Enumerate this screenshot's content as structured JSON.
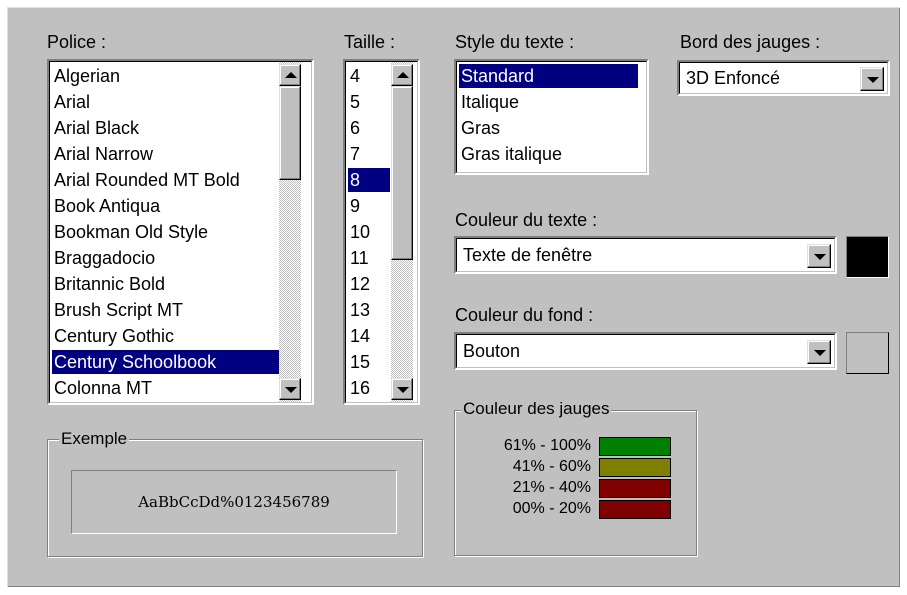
{
  "font": {
    "label": "Police :",
    "items": [
      "Algerian",
      "Arial",
      "Arial Black",
      "Arial Narrow",
      "Arial Rounded MT Bold",
      "Book Antiqua",
      "Bookman Old Style",
      "Braggadocio",
      "Britannic Bold",
      "Brush Script MT",
      "Century Gothic",
      "Century Schoolbook",
      "Colonna MT"
    ],
    "selected": "Century Schoolbook"
  },
  "size": {
    "label": "Taille :",
    "items": [
      "4",
      "5",
      "6",
      "7",
      "8",
      "9",
      "10",
      "11",
      "12",
      "13",
      "14",
      "15",
      "16"
    ],
    "selected": "8"
  },
  "text_style": {
    "label": "Style du texte :",
    "items": [
      "Standard",
      "Italique",
      "Gras",
      "Gras italique"
    ],
    "selected": "Standard"
  },
  "gauge_border": {
    "label": "Bord des jauges :",
    "value": "3D Enfoncé"
  },
  "text_color": {
    "label": "Couleur du texte :",
    "value": "Texte de fenêtre",
    "swatch": "#000000"
  },
  "bg_color": {
    "label": "Couleur du fond :",
    "value": "Bouton",
    "swatch": "#c0c0c0"
  },
  "gauge_colors": {
    "title": "Couleur des jauges",
    "ranges": [
      {
        "label": "61% - 100%",
        "color": "#008000"
      },
      {
        "label": "41% - 60%",
        "color": "#808000"
      },
      {
        "label": "21% - 40%",
        "color": "#800000"
      },
      {
        "label": "00% - 20%",
        "color": "#800000"
      }
    ]
  },
  "example": {
    "title": "Exemple",
    "sample": "AaBbCcDd%0123456789"
  }
}
